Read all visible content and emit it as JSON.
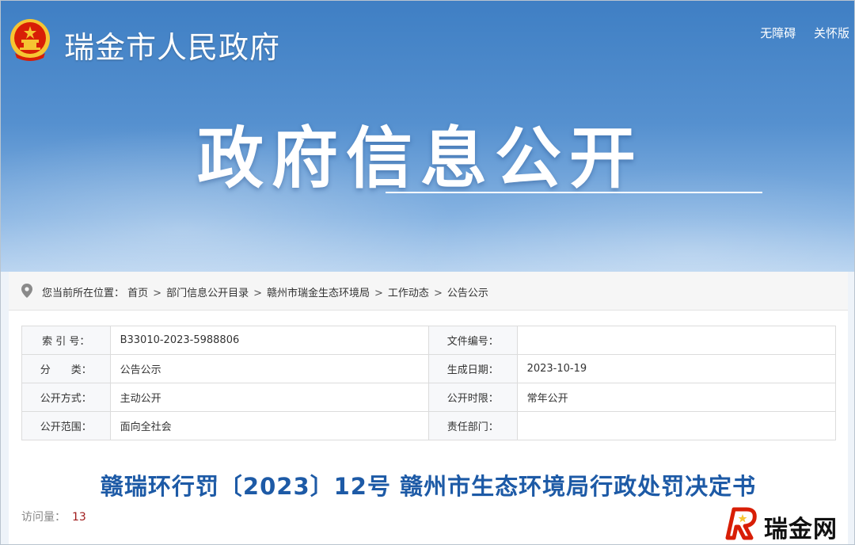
{
  "header": {
    "site_title": "瑞金市人民政府",
    "links": [
      "无障碍",
      "关怀版"
    ],
    "hero_title": "政府信息公开"
  },
  "breadcrumb": {
    "prefix": "您当前所在位置：",
    "items": [
      "首页",
      "部门信息公开目录",
      "赣州市瑞金生态环境局",
      "工作动态",
      "公告公示"
    ],
    "separator": ">"
  },
  "meta": {
    "rows": [
      {
        "l1": "索 引 号：",
        "v1": "B33010-2023-5988806",
        "l2": "文件编号：",
        "v2": ""
      },
      {
        "l1": "分　　类：",
        "v1": "公告公示",
        "l2": "生成日期：",
        "v2": "2023-10-19"
      },
      {
        "l1": "公开方式：",
        "v1": "主动公开",
        "l2": "公开时限：",
        "v2": "常年公开"
      },
      {
        "l1": "公开范围：",
        "v1": "面向全社会",
        "l2": "责任部门：",
        "v2": ""
      }
    ]
  },
  "document": {
    "title": "赣瑞环行罚〔2023〕12号 赣州市生态环境局行政处罚决定书",
    "visits_label": "访问量：",
    "visits_count": "13"
  },
  "watermark": {
    "text": "瑞金网"
  },
  "colors": {
    "banner_top": "#3f7fc4",
    "title_blue": "#1d5aa6",
    "count_red": "#a01c1c",
    "emblem_red": "#d81e06",
    "emblem_gold": "#f6c532"
  },
  "icons": {
    "breadcrumb": "location-pin-icon",
    "emblem": "national-emblem-icon"
  }
}
